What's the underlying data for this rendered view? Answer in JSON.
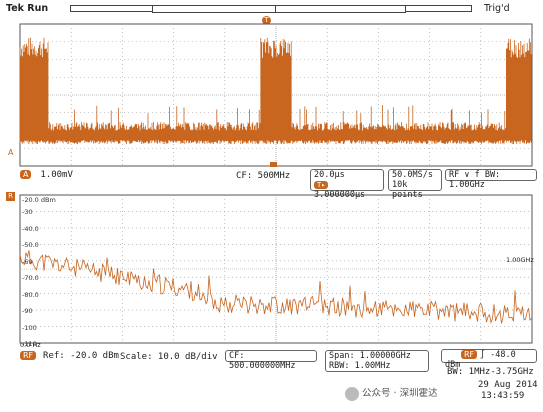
{
  "header": {
    "app_status": "Tek Run",
    "trigger_state": "Trig'd"
  },
  "time_domain": {
    "marker_letter": "T",
    "ground_marker": "A",
    "channel_label": "A",
    "vertical_scale": "1.00mV",
    "center_freq": "CF:  500MHz",
    "time_per_div": "20.0µs",
    "trigger_position": "3.000000µs",
    "sample_rate": "50.0MS/s",
    "record_length": "10k points",
    "trigger_info": "RF ∨ f BW: 1.00GHz"
  },
  "frequency_domain": {
    "indicator": "R",
    "y_axis_ticks": [
      "-20.0 dBm",
      "-30",
      "-40.0",
      "-50.0",
      "-60",
      "-70.0",
      "-80.0",
      "-90",
      "-100",
      "-110"
    ],
    "x_start": "0.0 Hz",
    "x_end": "1.00GHz",
    "ref_label": "RF",
    "ref_level": "Ref: -20.0 dBm",
    "scale": "Scale: 10.0 dB/div",
    "cf": "CF:  500.000000MHz",
    "span_label": "Span:",
    "span_value": "1.00000GHz",
    "rbw_label": "RBW:",
    "rbw_value": "1.00MHz",
    "rf_badge": "RF",
    "rf_trigger": "∫ -48.0 dBm",
    "bw": "BW: 1MHz-3.75GHz",
    "date": "29 Aug 2014",
    "time": "13:43:59"
  },
  "watermark": "公众号 · 深圳霍达",
  "colors": {
    "trace": "#c8651f",
    "grid": "#9a9a9a",
    "border": "#555555"
  }
}
